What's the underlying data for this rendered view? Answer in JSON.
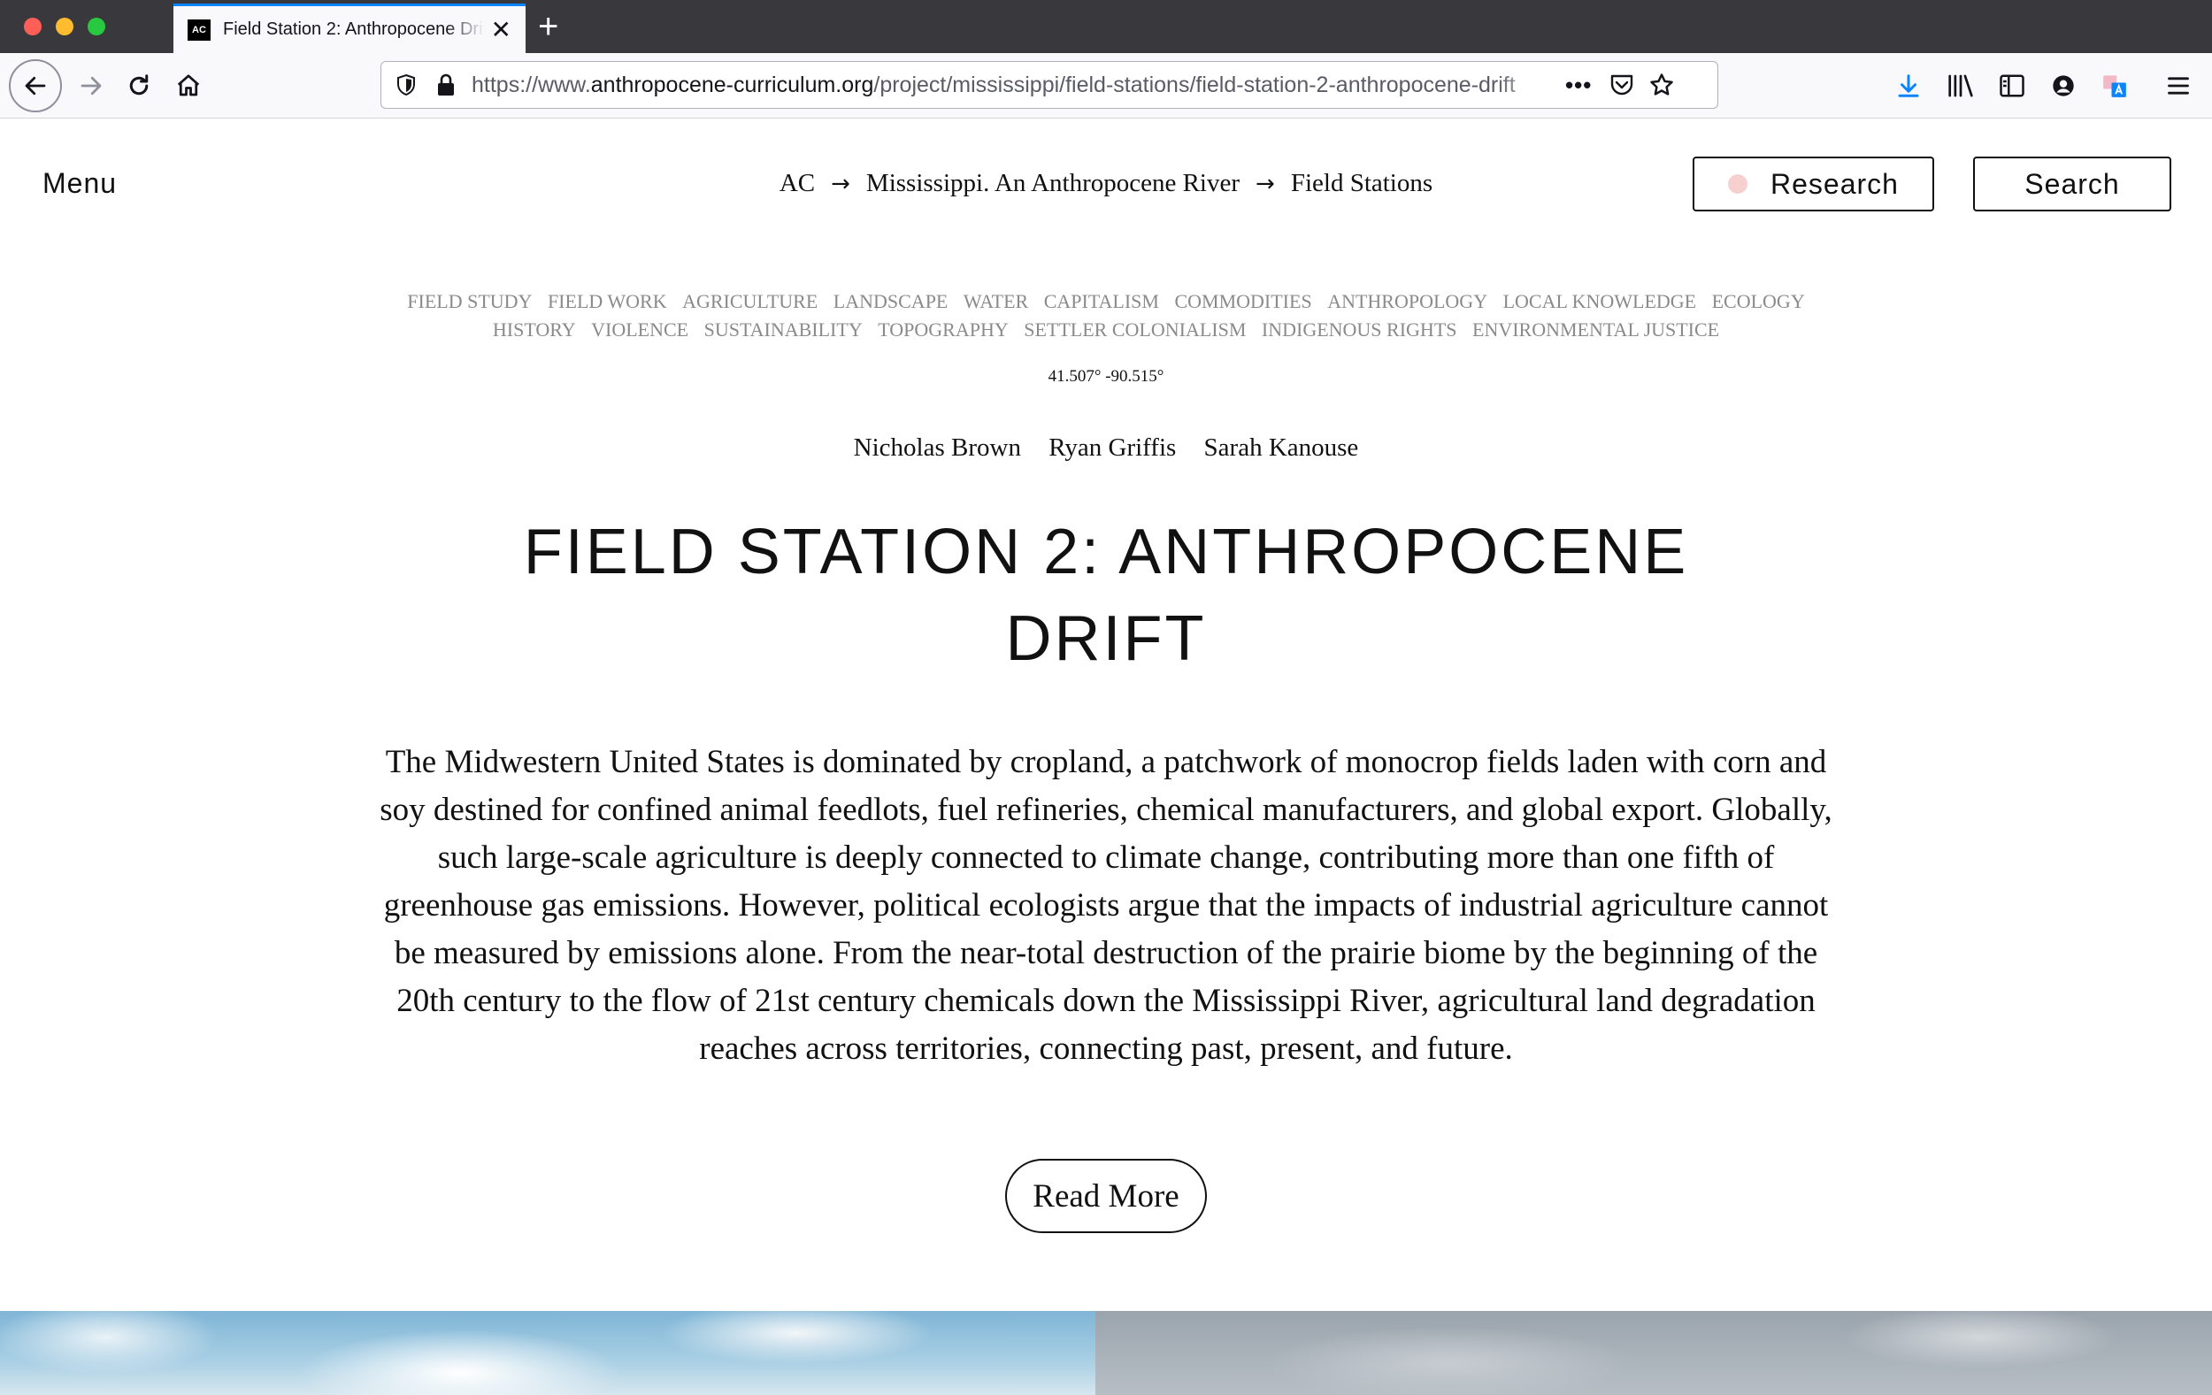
{
  "browser": {
    "tab_title": "Field Station 2: Anthropocene Drift",
    "favicon_text": "AC",
    "url_prefix": "https://www.",
    "url_host": "anthropocene-curriculum.org",
    "url_path": "/project/mississippi/field-stations/field-station-2-anthropocene-drift"
  },
  "header": {
    "menu_label": "Menu",
    "breadcrumb": [
      "AC",
      "Mississippi. An Anthropocene River",
      "Field Stations"
    ],
    "research_label": "Research",
    "search_label": "Search",
    "research_dot_color": "#f8cfcf"
  },
  "tags": [
    "FIELD STUDY",
    "FIELD WORK",
    "AGRICULTURE",
    "LANDSCAPE",
    "WATER",
    "CAPITALISM",
    "COMMODITIES",
    "ANTHROPOLOGY",
    "LOCAL KNOWLEDGE",
    "ECOLOGY",
    "HISTORY",
    "VIOLENCE",
    "SUSTAINABILITY",
    "TOPOGRAPHY",
    "SETTLER COLONIALISM",
    "INDIGENOUS RIGHTS",
    "ENVIRONMENTAL JUSTICE"
  ],
  "coordinates": "41.507° -90.515°",
  "authors": [
    "Nicholas Brown",
    "Ryan Griffis",
    "Sarah Kanouse"
  ],
  "title_line1": "FIELD STATION 2: ANTHROPOCENE",
  "title_line2": "DRIFT",
  "body": "The Midwestern United States is dominated by cropland, a patchwork of monocrop fields laden with corn and soy destined for confined animal feedlots, fuel refineries, chemical manufacturers, and global export. Globally, such large-scale agriculture is deeply connected to climate change, contributing more than one fifth of greenhouse gas emissions. However, political ecologists argue that the impacts of industrial agriculture cannot be measured by emissions alone. From the near-total destruction of the prairie biome by the beginning of the 20th century to the flow of 21st century chemicals down the Mississippi River, agricultural land degradation reaches across territories, connecting past, present, and future.",
  "read_more_label": "Read More"
}
